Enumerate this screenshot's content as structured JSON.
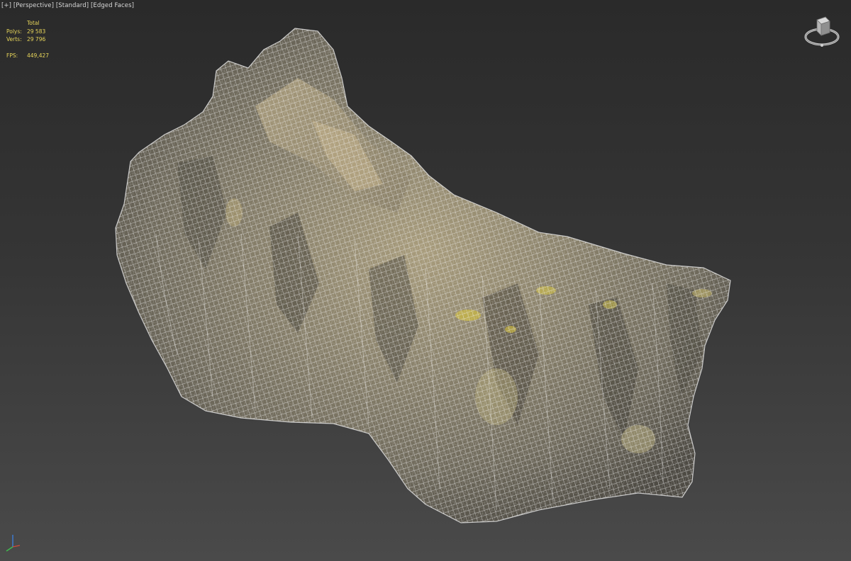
{
  "viewport": {
    "labels": {
      "plus": "[+]",
      "view": "[Perspective]",
      "shading": "[Standard]",
      "edges": "[Edged Faces]"
    },
    "stats": {
      "header": "Total",
      "polys_label": "Polys:",
      "polys_value": "29 583",
      "verts_label": "Verts:",
      "verts_value": "29 796",
      "fps_label": "FPS:",
      "fps_value": "449,427"
    },
    "stats_color": "#e8d65a",
    "navcube_icon": "viewcube-icon",
    "axis_icon": "axis-tripod-icon",
    "model_name": "rock-mesh-wireframe"
  }
}
